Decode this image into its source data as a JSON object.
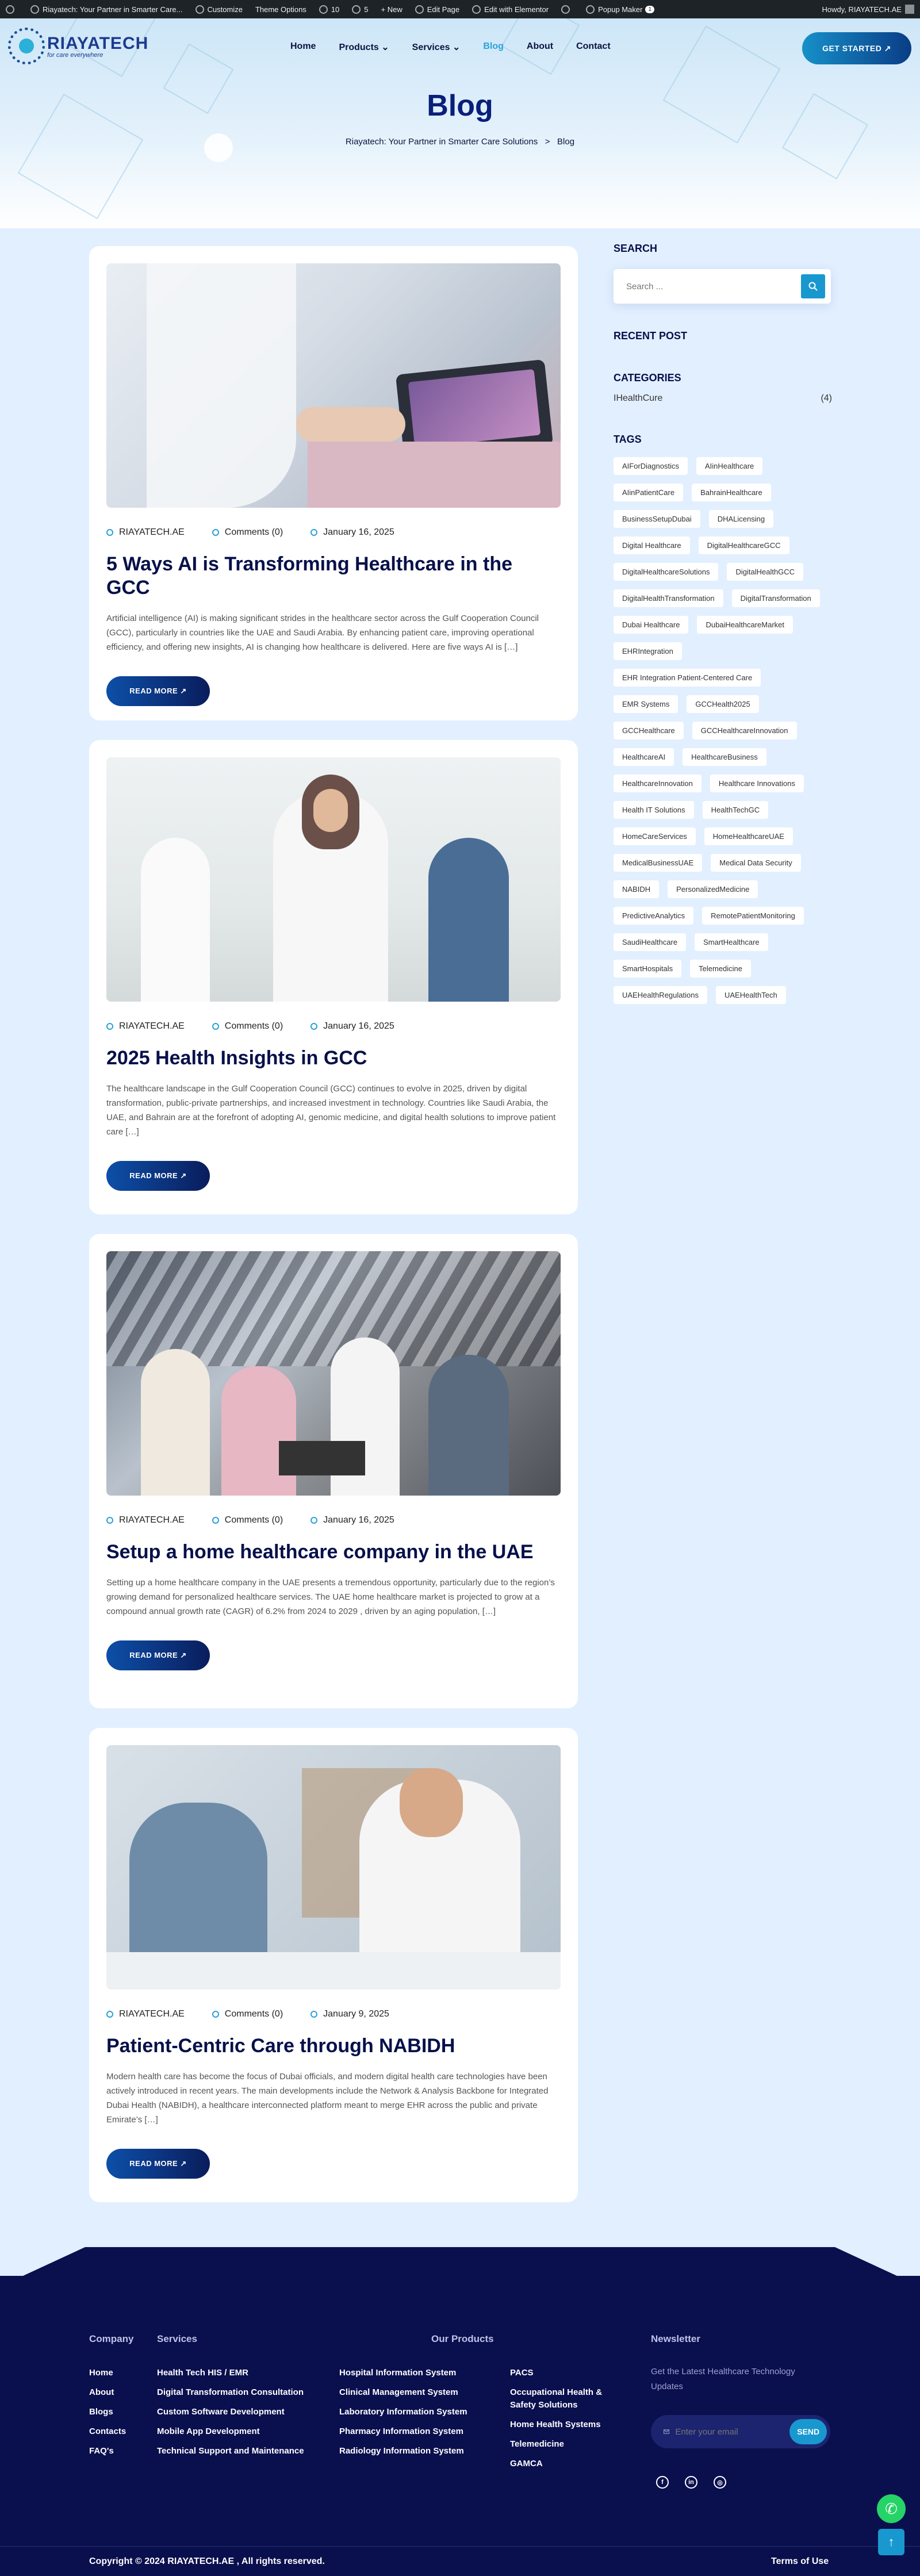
{
  "admin_bar": {
    "site_name": "Riayatech: Your Partner in Smarter Care...",
    "customize": "Customize",
    "theme_options": "Theme Options",
    "updates_count": "10",
    "comments_count": "5",
    "new": "+ New",
    "edit_page": "Edit Page",
    "edit_elementor": "Edit with Elementor",
    "popup_maker": "Popup Maker",
    "popup_badge": "1",
    "howdy": "Howdy, RIAYATECH.AE"
  },
  "header": {
    "logo_name": "RIAYATECH",
    "logo_tagline": "for care everywhere",
    "nav": [
      {
        "label": "Home"
      },
      {
        "label": "Products ⌄"
      },
      {
        "label": "Services ⌄"
      },
      {
        "label": "Blog"
      },
      {
        "label": "About"
      },
      {
        "label": "Contact"
      }
    ],
    "cta_label": "GET STARTED ↗"
  },
  "hero": {
    "title": "Blog",
    "breadcrumb_home": "Riayatech: Your Partner in Smarter Care Solutions",
    "breadcrumb_sep": ">",
    "breadcrumb_current": "Blog"
  },
  "posts": [
    {
      "author": "RIAYATECH.AE",
      "comments": "Comments (0)",
      "date": "January 16, 2025",
      "title": "5 Ways AI is Transforming Healthcare in the GCC",
      "excerpt": "Artificial intelligence (AI) is making significant strides in the healthcare sector across the Gulf Cooperation Council (GCC), particularly in countries like the UAE and Saudi Arabia. By enhancing patient care, improving operational efficiency, and offering new insights, AI is changing how healthcare is delivered. Here are five ways AI is […]",
      "read_more": "READ MORE ↗"
    },
    {
      "author": "RIAYATECH.AE",
      "comments": "Comments (0)",
      "date": "January 16, 2025",
      "title": "2025 Health Insights in GCC",
      "excerpt": "The healthcare landscape in the Gulf Cooperation Council (GCC) continues to evolve in 2025, driven by digital transformation, public-private partnerships, and increased investment in technology. Countries like Saudi Arabia, the UAE, and Bahrain are at the forefront of adopting AI, genomic medicine, and digital health solutions to improve patient care […]",
      "read_more": "READ MORE ↗"
    },
    {
      "author": "RIAYATECH.AE",
      "comments": "Comments (0)",
      "date": "January 16, 2025",
      "title": "Setup a home healthcare company in the UAE",
      "excerpt": "Setting up a home healthcare company in the UAE presents a tremendous opportunity, particularly due to the region’s growing demand for personalized healthcare services. The UAE home healthcare market is projected to grow at a compound annual growth rate (CAGR) of 6.2% from 2024 to 2029 , driven by an aging population, […]",
      "read_more": "READ MORE ↗"
    },
    {
      "author": "RIAYATECH.AE",
      "comments": "Comments (0)",
      "date": "January 9, 2025",
      "title": "Patient-Centric Care through NABIDH",
      "excerpt": "Modern health care has become the focus of Dubai officials, and modern digital health care technologies have been actively introduced in recent years. The main developments include the Network & Analysis Backbone for Integrated Dubai Health (NABIDH), a healthcare interconnected platform meant to merge EHR across the public and private Emirate’s […]",
      "read_more": "READ MORE ↗"
    }
  ],
  "sidebar": {
    "search_heading": "SEARCH",
    "search_placeholder": "Search ...",
    "recent_heading": "RECENT POST",
    "categories_heading": "CATEGORIES",
    "category_name": "IHealthCure",
    "category_count": "(4)",
    "tags_heading": "TAGS",
    "tags": [
      "AIForDiagnostics",
      "AIinHealthcare",
      "AIinPatientCare",
      "BahrainHealthcare",
      "BusinessSetupDubai",
      "DHALicensing",
      "Digital Healthcare",
      "DigitalHealthcareGCC",
      "DigitalHealthcareSolutions",
      "DigitalHealthGCC",
      "DigitalHealthTransformation",
      "DigitalTransformation",
      "Dubai Healthcare",
      "DubaiHealthcareMarket",
      "EHRIntegration",
      "EHR Integration Patient-Centered Care",
      "EMR Systems",
      "GCCHealth2025",
      "GCCHealthcare",
      "GCCHealthcareInnovation",
      "HealthcareAI",
      "HealthcareBusiness",
      "HealthcareInnovation",
      "Healthcare Innovations",
      "Health IT Solutions",
      "HealthTechGC",
      "HomeCareServices",
      "HomeHealthcareUAE",
      "MedicalBusinessUAE",
      "Medical Data Security",
      "NABIDH",
      "PersonalizedMedicine",
      "PredictiveAnalytics",
      "RemotePatientMonitoring",
      "SaudiHealthcare",
      "SmartHealthcare",
      "SmartHospitals",
      "Telemedicine",
      "UAEHealthRegulations",
      "UAEHealthTech"
    ]
  },
  "footer": {
    "company_heading": "Company",
    "company_links": [
      "Home",
      "About",
      "Blogs",
      "Contacts",
      "FAQ's"
    ],
    "services_heading": "Services",
    "services_links": [
      "Health Tech HIS / EMR",
      "Digital Transformation Consultation",
      "Custom Software Development",
      "Mobile App Development",
      "Technical Support and Maintenance"
    ],
    "products_heading": "Our Products",
    "products_col1": [
      "Hospital Information System",
      "Clinical Management System",
      "Laboratory Information System",
      "Pharmacy Information System",
      "Radiology Information System"
    ],
    "products_col2": [
      "PACS",
      "Occupational Health &",
      "Safety Solutions",
      "Home Health Systems",
      "Telemedicine",
      "GAMCA"
    ],
    "newsletter_heading": "Newsletter",
    "newsletter_text": "Get the Latest Healthcare Technology Updates",
    "email_placeholder": "Enter your email",
    "send_label": "SEND",
    "social": [
      "f",
      "in",
      "◎"
    ],
    "copyright": "Copyright © 2024 RIAYATECH.AE , All rights reserved.",
    "terms": "Terms of Use"
  }
}
